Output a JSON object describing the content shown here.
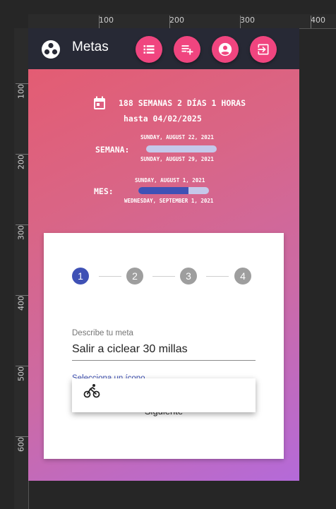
{
  "ruler": {
    "top_labels": [
      "100",
      "200",
      "300",
      "400"
    ],
    "left_labels": [
      "100",
      "200",
      "300",
      "400",
      "500",
      "600"
    ]
  },
  "toolbar": {
    "title": "Metas",
    "logo_icon": "workspaces-icon",
    "actions": [
      {
        "name": "list-button",
        "icon": "list-icon"
      },
      {
        "name": "add-goal-button",
        "icon": "playlist-add-icon"
      },
      {
        "name": "account-button",
        "icon": "account-circle-icon"
      },
      {
        "name": "logout-button",
        "icon": "exit-to-app-icon"
      }
    ],
    "action_color": "#f0457f",
    "background": "#272935"
  },
  "countdown": {
    "text": "188 SEMANAS 2 DÍAS 1 HORAS",
    "until": "hasta 04/02/2025",
    "icon": "calendar-icon"
  },
  "week": {
    "label": "SEMANA:",
    "start": "SUNDAY, AUGUST 22, 2021",
    "end": "SUNDAY, AUGUST 29, 2021",
    "progress": 0
  },
  "month": {
    "label": "MES:",
    "start": "SUNDAY, AUGUST 1, 2021",
    "end": "WEDNESDAY, SEPTEMBER 1, 2021",
    "progress": 0.71
  },
  "stepper": {
    "steps": [
      "1",
      "2",
      "3",
      "4"
    ],
    "active_color": "#3f51b5",
    "inactive_color": "#9e9e9e"
  },
  "form": {
    "goal_label": "Describe tu meta",
    "goal_value": "Salir a ciclear 30 millas",
    "icon_label": "Selecciona un ícono",
    "icon_value": "directions_bike",
    "next_label": "Siguiente"
  },
  "autocomplete": {
    "option_icon": "directions-bike-icon"
  }
}
